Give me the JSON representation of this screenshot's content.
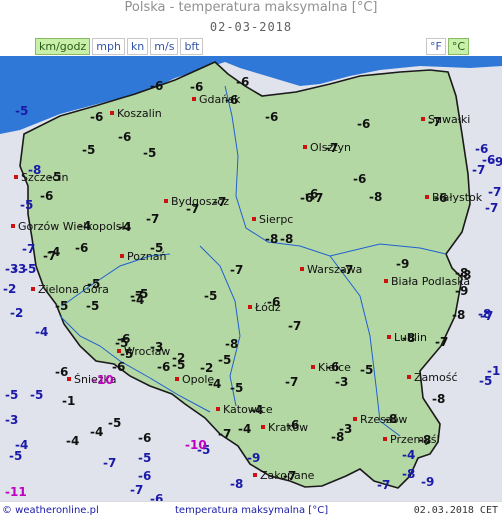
{
  "header": {
    "title": "Polska - temperatura maksymalna [°C]",
    "date": "02-03-2018"
  },
  "speed_units": [
    {
      "label": "km/godz",
      "active": true
    },
    {
      "label": "mph",
      "active": false
    },
    {
      "label": "kn",
      "active": false
    },
    {
      "label": "m/s",
      "active": false
    },
    {
      "label": "bft",
      "active": false
    }
  ],
  "temp_units": [
    {
      "label": "°F",
      "active": false
    },
    {
      "label": "°C",
      "active": true
    }
  ],
  "colors": {
    "land": "#b4d8a4",
    "neighbour": "#e0e2ec",
    "sea": "#2f78d8",
    "border": "#1a1a1a",
    "river": "#2060d0",
    "city_dot": "#cc1111"
  },
  "cities": [
    {
      "name": "Koszalin",
      "temp": "-6"
    },
    {
      "name": "Gdańsk",
      "temp": "-6"
    },
    {
      "name": "Suwałki",
      "temp": "-7"
    },
    {
      "name": "Szczecin",
      "temp": "-5"
    },
    {
      "name": "Olsztyn",
      "temp": "-7"
    },
    {
      "name": "Bydgoszcz",
      "temp": "-7"
    },
    {
      "name": "Białystok",
      "temp": "-6"
    },
    {
      "name": "Sierpc",
      "temp": "-8"
    },
    {
      "name": "Gorzów Wielkopolski",
      "temp": "-4"
    },
    {
      "name": "Poznań",
      "temp": "-5"
    },
    {
      "name": "Warszawa",
      "temp": "-7"
    },
    {
      "name": "Biała Podlaska",
      "temp": "-8"
    },
    {
      "name": "Zielona Góra",
      "temp": "-5"
    },
    {
      "name": "Łódź",
      "temp": "-6"
    },
    {
      "name": "Lublin",
      "temp": "-8"
    },
    {
      "name": "Wrocław",
      "temp": "-3"
    },
    {
      "name": "Opole",
      "temp": "-2"
    },
    {
      "name": "Kielce",
      "temp": "-6"
    },
    {
      "name": "Zamość",
      "temp": ""
    },
    {
      "name": "Śnieżka",
      "temp": "-10"
    },
    {
      "name": "Katowice",
      "temp": "-4"
    },
    {
      "name": "Kraków",
      "temp": "-6"
    },
    {
      "name": "Rzeszów",
      "temp": "-8"
    },
    {
      "name": "Przemyśl",
      "temp": "-8"
    },
    {
      "name": "Zakopane",
      "temp": "-7"
    }
  ],
  "extra_temps": [
    "-5",
    "-6",
    "-6",
    "-6",
    "-6",
    "-5",
    "-5",
    "-6",
    "-6",
    "-6",
    "-6",
    "-6",
    "-7",
    "-8",
    "-8",
    "-6",
    "-7",
    "-6",
    "-6",
    "-8",
    "-7",
    "-5",
    "-4",
    "-7",
    "-7",
    "-7",
    "-6",
    "-5",
    "-7",
    "-5",
    "-5",
    "-4",
    "-7",
    "-6",
    "-6",
    "-6",
    "-6",
    "-8",
    "-3",
    "-8",
    "-5",
    "-9",
    "-4",
    "-3",
    "-2",
    "-8",
    "-5",
    "-5",
    "-4",
    "-2",
    "-9",
    "-9",
    "-5",
    "-5",
    "-8",
    "-5",
    "-7",
    "-4",
    "-3",
    "-5",
    "-5",
    "-1",
    "-5",
    "-4",
    "-2",
    "-3",
    "-5",
    "-5",
    "-4",
    "-6",
    "-5",
    "-4",
    "-7",
    "-7",
    "-5",
    "-4",
    "-7",
    "-8",
    "-9",
    "-8",
    "-10",
    "-3",
    "-8",
    "-9",
    "-7",
    "-4",
    "-6",
    "-5",
    "-7",
    "-7",
    "-7",
    "-7",
    "-8",
    "-5",
    "-7",
    "-6",
    "-11",
    "-1"
  ],
  "footer": {
    "brand": "© weatheronline.pl",
    "label": "temperatura maksymalna [°C]",
    "datetime": "02.03.2018 CET"
  }
}
